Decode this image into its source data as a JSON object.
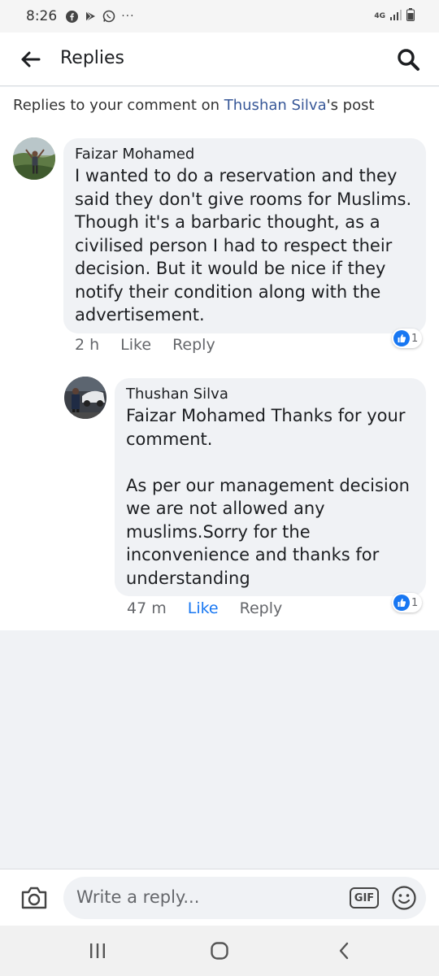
{
  "status_bar": {
    "time": "8:26",
    "notification_icons": [
      "facebook-icon",
      "play-store-icon",
      "whatsapp-icon",
      "more-dots-icon"
    ],
    "more": "···",
    "network": "4G"
  },
  "header": {
    "title": "Replies",
    "back_icon": "back-arrow-icon",
    "search_icon": "search-icon"
  },
  "context": {
    "prefix": "Replies to your comment on ",
    "post_author": "Thushan Silva",
    "suffix": "'s post"
  },
  "comments": [
    {
      "author": "Faizar Mohamed",
      "text": "I wanted to do a reservation and they\nsaid they don't give rooms for Muslims.\nThough it's a barbaric thought, as a\ncivilised person I had to respect their\ndecision. But it would  be nice if they\nnotify their condition along with the\nadvertisement.",
      "time": "2 h",
      "like": "Like",
      "reply": "Reply",
      "reaction_count": "1",
      "liked": false
    },
    {
      "author": "Thushan Silva",
      "mention": "Faizar Mohamed",
      "text": " Thanks for your\ncomment.\n\nAs per our management decision\nwe are not allowed any\nmuslims.Sorry for the\ninconvenience and thanks for\nunderstanding",
      "time": "47 m",
      "like": "Like",
      "reply": "Reply",
      "reaction_count": "1",
      "liked": true
    }
  ],
  "composer": {
    "placeholder": "Write a reply...",
    "gif_label": "GIF"
  },
  "colors": {
    "link_blue": "#385898",
    "like_blue": "#1877f2",
    "bubble_gray": "#f0f2f5",
    "meta_gray": "#65676b"
  }
}
